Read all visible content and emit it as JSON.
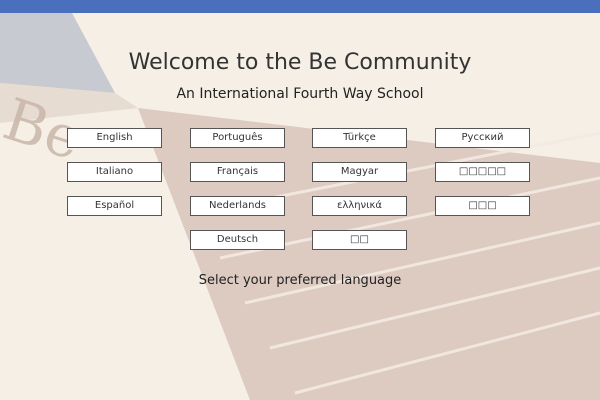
{
  "header": {
    "title": "Welcome to the Be Community",
    "subtitle": "An International Fourth Way School"
  },
  "background": {
    "logo_text": "Be"
  },
  "languages": [
    "English",
    "Português",
    "Türkçe",
    "Русский",
    "Italiano",
    "Français",
    "Magyar",
    "□□□□□",
    "Español",
    "Nederlands",
    "ελληνικά",
    "□□□",
    "Deutsch",
    "□□"
  ],
  "footer": {
    "prompt": "Select your preferred language"
  },
  "colors": {
    "top_bar": "#4a6fbd",
    "background": "#f5efe6"
  }
}
